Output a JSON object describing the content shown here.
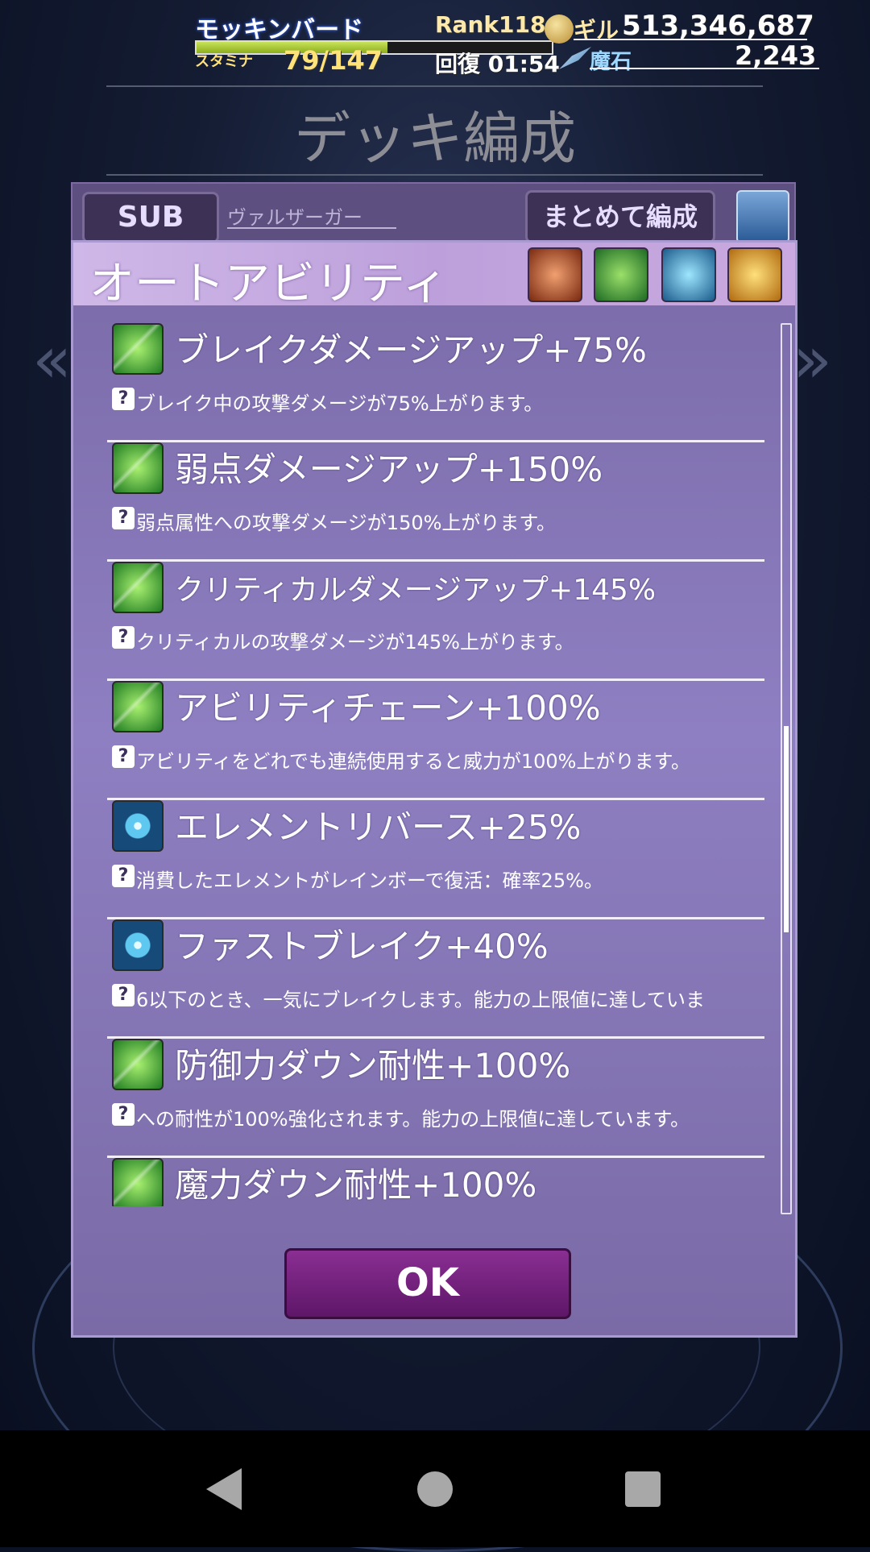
{
  "header": {
    "player_name": "モッキンバード",
    "stamina_label": "スタミナ",
    "stamina_value": "79/147",
    "stamina_fraction": 0.537,
    "recovery": "回復 01:54",
    "rank": "Rank118",
    "gil_label": "ギル",
    "gil_value": "513,346,687",
    "magicite_label": "魔石",
    "magicite_value": "2,243"
  },
  "screen_title": "デッキ編成",
  "deck": {
    "sub_button": "SUB",
    "character_name": "ヴァルザーガー",
    "bulk_button": "まとめて編成"
  },
  "dialog": {
    "title": "オートアビリティ",
    "header_icons": [
      "crystal-orange-icon",
      "crystal-green-icon",
      "crystal-blue-icon",
      "crystal-gold-icon"
    ],
    "abilities": [
      {
        "name": "ブレイクダメージアップ+75%",
        "desc": "ブレイク中の攻撃ダメージが75%上がります。",
        "icon": "green"
      },
      {
        "name": "弱点ダメージアップ+150%",
        "desc": "弱点属性への攻撃ダメージが150%上がります。",
        "icon": "green"
      },
      {
        "name": "クリティカルダメージアップ+145%",
        "desc": "クリティカルの攻撃ダメージが145%上がります。",
        "icon": "green"
      },
      {
        "name": "アビリティチェーン+100%",
        "desc": "アビリティをどれでも連続使用すると威力が100%上がります。",
        "icon": "green"
      },
      {
        "name": "エレメントリバース+25%",
        "desc": "消費したエレメントがレインボーで復活：確率25%。",
        "icon": "blue"
      },
      {
        "name": "ファストブレイク+40%",
        "desc": "6以下のとき、一気にブレイクします。能力の上限値に達していま",
        "icon": "blue"
      },
      {
        "name": "防御力ダウン耐性+100%",
        "desc": "への耐性が100%強化されます。能力の上限値に達しています。",
        "icon": "green"
      },
      {
        "name": "魔力ダウン耐性+100%",
        "desc": "",
        "icon": "green"
      }
    ],
    "ok_button": "OK"
  }
}
